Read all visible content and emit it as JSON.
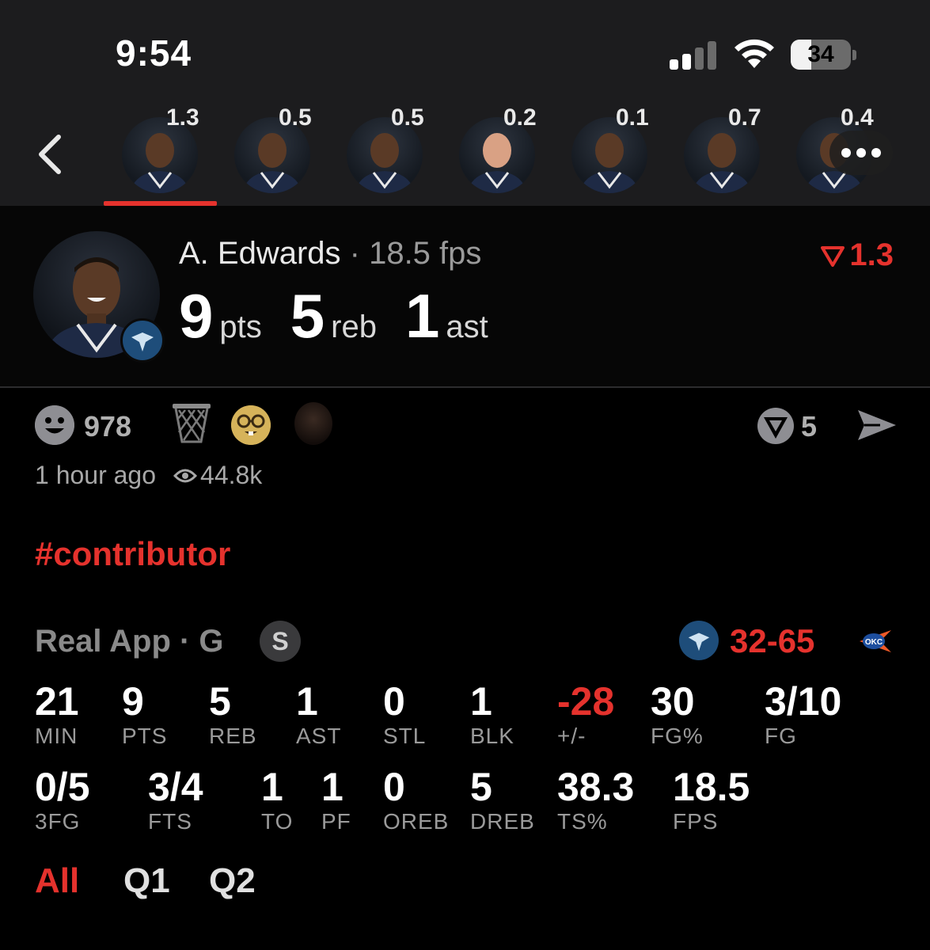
{
  "status_bar": {
    "time": "9:54",
    "battery": "34",
    "battery_level": 0.34
  },
  "player_strip": {
    "items": [
      {
        "rating": "1.3",
        "active": true
      },
      {
        "rating": "0.5"
      },
      {
        "rating": "0.5"
      },
      {
        "rating": "0.2"
      },
      {
        "rating": "0.1"
      },
      {
        "rating": "0.7"
      },
      {
        "rating": "0.4"
      }
    ],
    "more_icon": "ellipsis-icon"
  },
  "player": {
    "name": "A. Edwards",
    "separator": " · ",
    "fps": "18.5 fps",
    "pts": "9",
    "pts_unit": "pts",
    "reb": "5",
    "reb_unit": "reb",
    "ast": "1",
    "ast_unit": "ast",
    "rating": "1.3"
  },
  "post": {
    "reaction_count": "978",
    "vote_count": "5",
    "time_ago": "1 hour ago",
    "views": "44.8k",
    "hashtag": "#contributor"
  },
  "game": {
    "label": "Real App · G",
    "badge": "S",
    "score": "32-65"
  },
  "stats_row1": [
    {
      "value": "21",
      "label": "MIN"
    },
    {
      "value": "9",
      "label": "PTS"
    },
    {
      "value": "5",
      "label": "REB"
    },
    {
      "value": "1",
      "label": "AST"
    },
    {
      "value": "0",
      "label": "STL"
    },
    {
      "value": "1",
      "label": "BLK"
    },
    {
      "value": "-28",
      "label": "+/-"
    },
    {
      "value": "30",
      "label": "FG%"
    },
    {
      "value": "3/10",
      "label": "FG"
    }
  ],
  "stats_row2": [
    {
      "value": "0/5",
      "label": "3FG"
    },
    {
      "value": "3/4",
      "label": "FTS"
    },
    {
      "value": "1",
      "label": "TO"
    },
    {
      "value": "1",
      "label": "PF"
    },
    {
      "value": "0",
      "label": "OREB"
    },
    {
      "value": "5",
      "label": "DREB"
    },
    {
      "value": "38.3",
      "label": "TS%"
    },
    {
      "value": "18.5",
      "label": "FPS"
    }
  ],
  "period_tabs": [
    {
      "label": "All",
      "active": true
    },
    {
      "label": "Q1"
    },
    {
      "label": "Q2"
    }
  ],
  "colors": {
    "accent": "#e5322d",
    "background": "#000000",
    "strip_bg": "#1c1c1e"
  }
}
